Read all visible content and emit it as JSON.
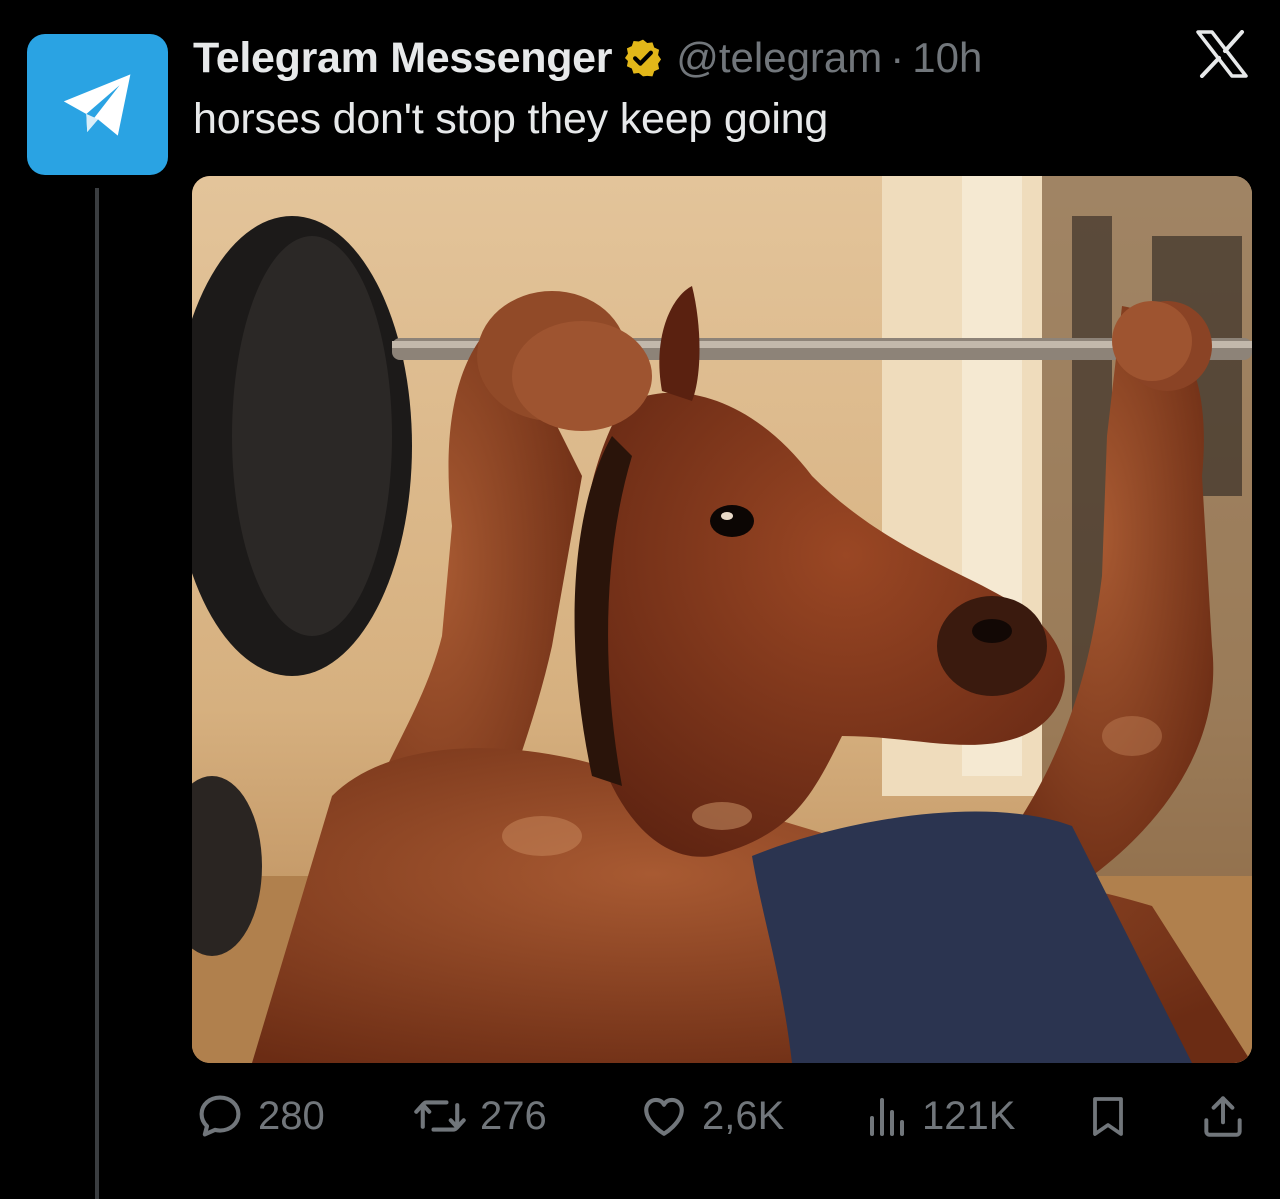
{
  "tweet": {
    "author_name": "Telegram Messenger",
    "handle": "@telegram",
    "separator": "·",
    "time": "10h",
    "text": "horses don't stop they keep going",
    "avatar_icon": "telegram-paper-plane-icon",
    "verified_icon": "gold-verified-badge-icon",
    "brand_logo": "x-logo-icon",
    "media_alt_icon": "horse-head-bodybuilder-image"
  },
  "actions": {
    "replies": "280",
    "reposts": "276",
    "likes": "2,6K",
    "views": "121K"
  },
  "colors": {
    "background": "#000000",
    "text": "#e7e9ea",
    "muted": "#71767b",
    "avatar": "#2aa3e3",
    "verified": "#e2b719",
    "thread_line": "#3a3d40"
  }
}
